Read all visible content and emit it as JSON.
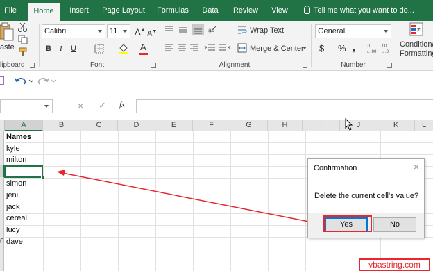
{
  "ribbon_tabs": [
    "File",
    "Home",
    "Insert",
    "Page Layout",
    "Formulas",
    "Data",
    "Review",
    "View"
  ],
  "tell_me": "Tell me what you want to do...",
  "clipboard": {
    "paste_label": "aste",
    "group_label": "lipboard"
  },
  "font": {
    "name": "Calibri",
    "size": "11",
    "grow": "A",
    "shrink": "A",
    "bold": "B",
    "italic": "I",
    "underline": "U",
    "font_color": "A",
    "group_label": "Font"
  },
  "alignment": {
    "wrap_text": "Wrap Text",
    "merge_center": "Merge & Center",
    "group_label": "Alignment"
  },
  "number": {
    "format": "General",
    "currency": "$",
    "percent": "%",
    "comma": ",",
    "group_label": "Number"
  },
  "styles": {
    "conditional_line1": "Conditional",
    "conditional_line2": "Formatting"
  },
  "formula_bar": {
    "fx": "fx",
    "cancel": "×",
    "enter": "✓",
    "value": ""
  },
  "columns": [
    "A",
    "B",
    "C",
    "D",
    "E",
    "F",
    "G",
    "H",
    "I",
    "J",
    "K",
    "L"
  ],
  "cells": [
    "Names",
    "kyle",
    "milton",
    "",
    "simon",
    "jeni",
    "jack",
    "cereal",
    "lucy",
    "dave"
  ],
  "row_numbers": [
    "0"
  ],
  "dialog": {
    "title": "Confirmation",
    "close": "×",
    "message": "Delete the current cell's value?",
    "yes": "Yes",
    "no": "No"
  },
  "watermark": "vbastring.com",
  "colors": {
    "excel_green": "#217346",
    "annotation_red": "#e8262b"
  }
}
